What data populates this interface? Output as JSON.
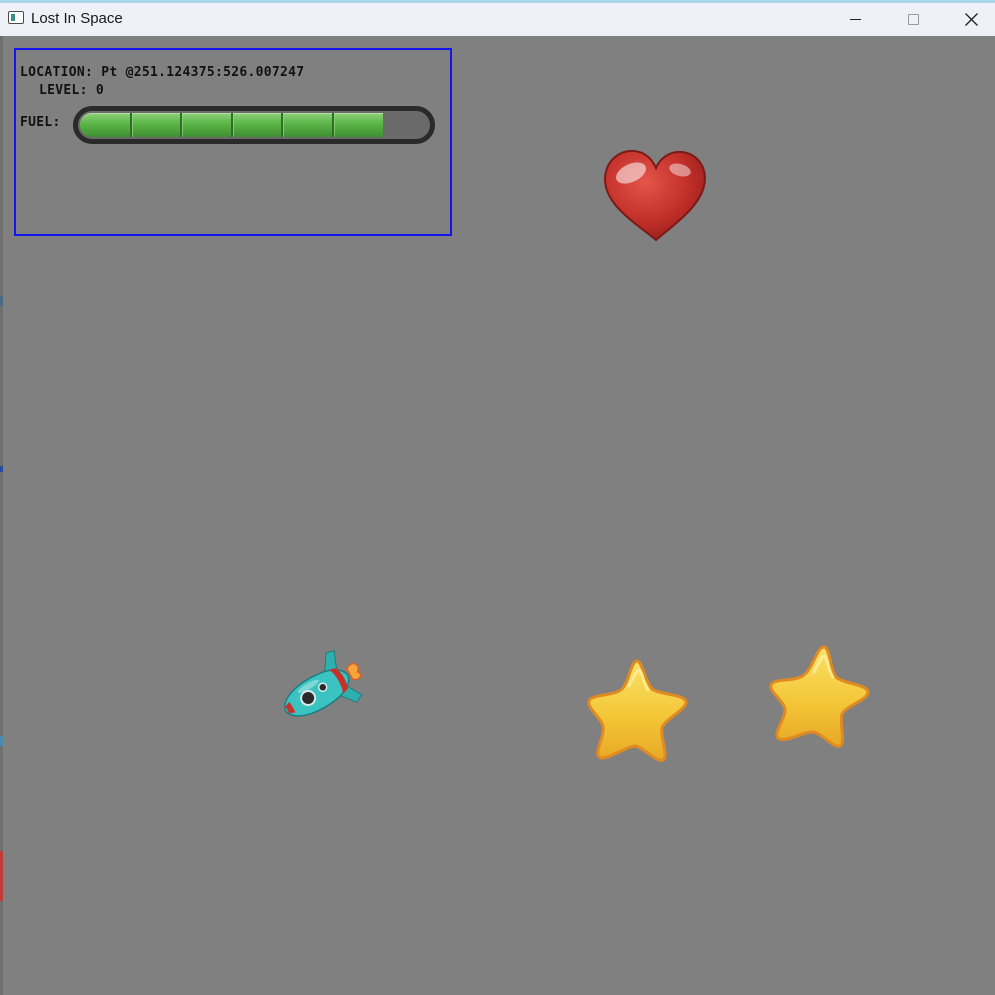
{
  "window": {
    "title": "Lost In Space",
    "controls": {
      "minimize": "minimize-icon",
      "maximize": "maximize-icon",
      "close": "close-icon"
    }
  },
  "game": {
    "background_color": "#808080",
    "hud": {
      "border_color": "#1515ee",
      "location_text": "LOCATION: Pt @251.124375:526.007247",
      "level_text": "LEVEL: 0",
      "fuel_label": "FUEL:",
      "fuel_level": 0.87,
      "fuel_segments": 7
    },
    "objects": [
      {
        "type": "heart",
        "icon": "heart-icon",
        "color": "#c8322b"
      },
      {
        "type": "star",
        "icon": "star-icon",
        "color": "#f2c833"
      },
      {
        "type": "star",
        "icon": "star-icon",
        "color": "#f2c833"
      },
      {
        "type": "player",
        "icon": "rocket-icon",
        "color": "#3bb9b8"
      }
    ]
  }
}
